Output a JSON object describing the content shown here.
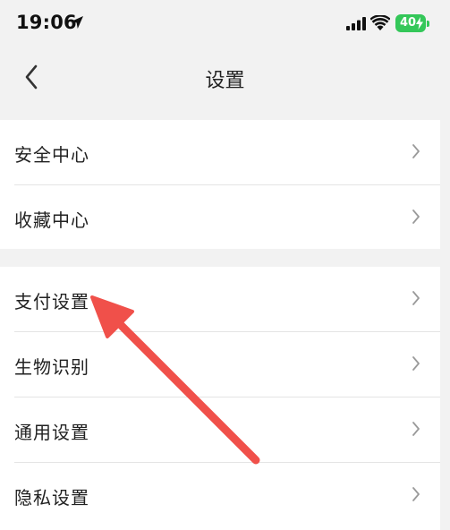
{
  "status_bar": {
    "time": "19:06",
    "battery_level": "40",
    "battery_color": "#34c759"
  },
  "nav": {
    "title": "设置",
    "back_icon": "chevron-left-icon"
  },
  "sections": [
    {
      "items": [
        {
          "label": "安全中心",
          "icon": "chevron-right-icon"
        },
        {
          "label": "收藏中心",
          "icon": "chevron-right-icon"
        }
      ]
    },
    {
      "items": [
        {
          "label": "支付设置",
          "icon": "chevron-right-icon"
        },
        {
          "label": "生物识别",
          "icon": "chevron-right-icon"
        },
        {
          "label": "通用设置",
          "icon": "chevron-right-icon"
        },
        {
          "label": "隐私设置",
          "icon": "chevron-right-icon"
        }
      ]
    }
  ],
  "annotation": {
    "color": "#f0504a",
    "target": "支付设置"
  }
}
